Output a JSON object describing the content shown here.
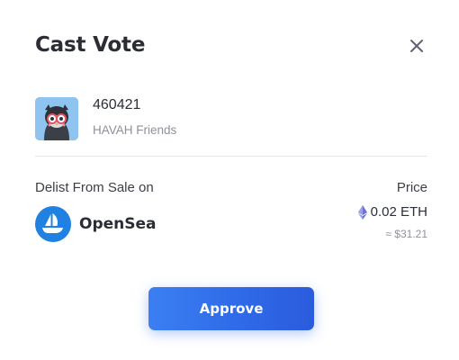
{
  "modal": {
    "title": "Cast Vote",
    "close_icon": "close-icon"
  },
  "nft": {
    "token_id": "460421",
    "collection": "HAVAH Friends",
    "thumbnail_icon": "owl-avatar-icon"
  },
  "action": {
    "label": "Delist From Sale on",
    "marketplace": "OpenSea",
    "marketplace_icon": "opensea-logo-icon"
  },
  "price": {
    "label": "Price",
    "amount": "0.02 ETH",
    "currency_icon": "eth-icon",
    "usd_equivalent": "≈ $31.21"
  },
  "buttons": {
    "approve_label": "Approve"
  },
  "colors": {
    "primary": "#2f6ae8",
    "opensea_blue": "#2081e2",
    "text_dark": "#2a2d34",
    "text_muted": "#8c919b"
  }
}
